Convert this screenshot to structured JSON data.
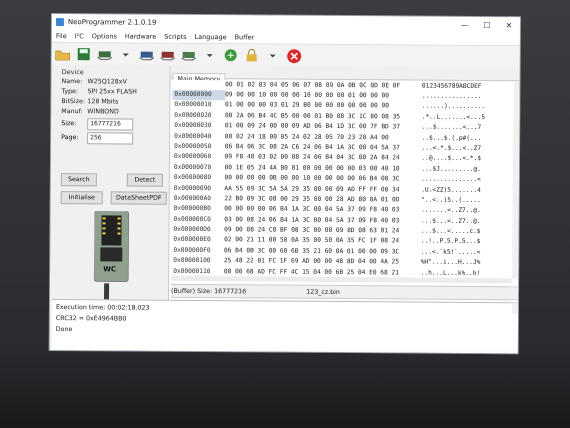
{
  "window": {
    "title": "NeoProgrammer 2.1.0.19",
    "min": "—",
    "max": "☐",
    "close": "✕"
  },
  "menu": [
    "File",
    "I²C",
    "Options",
    "Hardware",
    "Scripts",
    "Language",
    "Buffer"
  ],
  "device": {
    "group_title": "Device",
    "name_label": "Name:",
    "name": "W25Q128xV",
    "type_label": "Type:",
    "type": "SPI 25xx FLASH",
    "bitsize_label": "BitSize:",
    "bitsize": "128 Mbits",
    "manuf_label": "Manuf:",
    "manuf": "WINBOND",
    "size_label": "Size:",
    "size": "16777216",
    "page_label": "Page:",
    "page": "256"
  },
  "buttons": {
    "search": "Search",
    "detect": "Detect",
    "initialise": "Initialise",
    "datasheet": "DataSheetPDF"
  },
  "chip_label": "WC",
  "tab": "Main Memory",
  "hex": {
    "header": "00 01 02 03 04 05 06 07 08 09 0A 0B 0C 0D 0E 0F",
    "ascii_header": "0123456789ABCDEF",
    "rows": [
      {
        "addr": "0x00000000",
        "bytes": "09 00 00 10 00 00 00 10 00 00 00 01 00 00 00",
        "ascii": "................"
      },
      {
        "addr": "0x00000010",
        "bytes": "01 00 00 00 03 01 29 B0 00 00 00 00 00 00 00",
        "ascii": "......).........."
      },
      {
        "addr": "0x00000020",
        "bytes": "00 2A 06 B4 4C B5 00 00 01 B0 08 3C 1C 80 08 35",
        "ascii": ".*..L.......<...5"
      },
      {
        "addr": "0x00000030",
        "bytes": "01 00 09 24 00 00 09 AD 06 B4 1D 3C 00 7F BD 37",
        "ascii": "...$.......<...7"
      },
      {
        "addr": "0x00000040",
        "bytes": "00 02 24 18 00 05 24 02 28 05 70 23 28 A4 00",
        "ascii": "..$...$.(.p#(..."
      },
      {
        "addr": "0x00000050",
        "bytes": "06 B4 06 3C 08 2A C6 24 06 B4 1A 3C 00 04 5A 37",
        "ascii": "...<.*.$...<..Z7"
      },
      {
        "addr": "0x00000060",
        "bytes": "09 F8 40 03 02 00 08 24 06 B4 04 3C 00 2A 84 24",
        "ascii": "..@....$...<.*.$"
      },
      {
        "addr": "0x00000070",
        "bytes": "00 1E 05 24 4A 80 01 00 00 00 00 00 03 00 40 10",
        "ascii": "...$J.........@."
      },
      {
        "addr": "0x00000080",
        "bytes": "00 00 00 00 0B 00 00 10 00 00 00 00 06 B4 08 3C",
        "ascii": "...............<"
      },
      {
        "addr": "0x00000090",
        "bytes": "AA 55 09 3C 5A 5A 29 35 00 00 09 AD FF FF 08 34",
        "ascii": ".U.<ZZ)5.......4"
      },
      {
        "addr": "0x000000A0",
        "bytes": "22 B0 09 3C 08 00 29 35 00 00 28 AD 80 8A 01 0D",
        "ascii": "\"..<..)5..(....."
      },
      {
        "addr": "0x000000B0",
        "bytes": "00 00 00 00 06 B4 1A 3C 00 04 5A 37 09 F8 40 03",
        "ascii": ".......<..Z7..@."
      },
      {
        "addr": "0x000000C0",
        "bytes": "03 00 08 24 06 B4 1A 3C 00 04 5A 37 09 F8 40 03",
        "ascii": "...$...<..Z7..@."
      },
      {
        "addr": "0x000000D0",
        "bytes": "09 00 08 24 C8 BF 08 3C 00 00 09 8D 08 63 01 24",
        "ascii": "...$...<.....c.$"
      },
      {
        "addr": "0x000000E0",
        "bytes": "02 00 21 11 00 50 0A 35 00 50 0A 35 FC 1F 08 24",
        "ascii": "..!..P.5.P.5...$"
      },
      {
        "addr": "0x000000F0",
        "bytes": "06 B4 0B 3C 00 60 6B 35 21 60 0A 01 00 00 09 3C",
        "ascii": "...<.`k5!`.....<"
      },
      {
        "addr": "0x00000100",
        "bytes": "25 48 22 01 FC 1F 69 AD 00 00 48 8D 04 00 4A 25",
        "ascii": "%H\"...i...H...J%"
      },
      {
        "addr": "0x00000110",
        "bytes": "08 00 68 AD FC FF 4C 15 04 00 6B 25 04 E0 68 21",
        "ascii": "..h...L...k%..h!"
      }
    ]
  },
  "status": {
    "buffer_size": "(Buffer) Size: 16777216",
    "file": "123_cz.bin"
  },
  "log": {
    "line1": "Execution time: 00:02:18.023",
    "line2": "CRC32 = 0xE4964BB0",
    "line3": "Done"
  },
  "colors": {
    "accent": "#3a86d6",
    "selected_addr": "#cfd8e6",
    "close_red": "#d92b2b",
    "chip_green": "#8fa08f"
  }
}
